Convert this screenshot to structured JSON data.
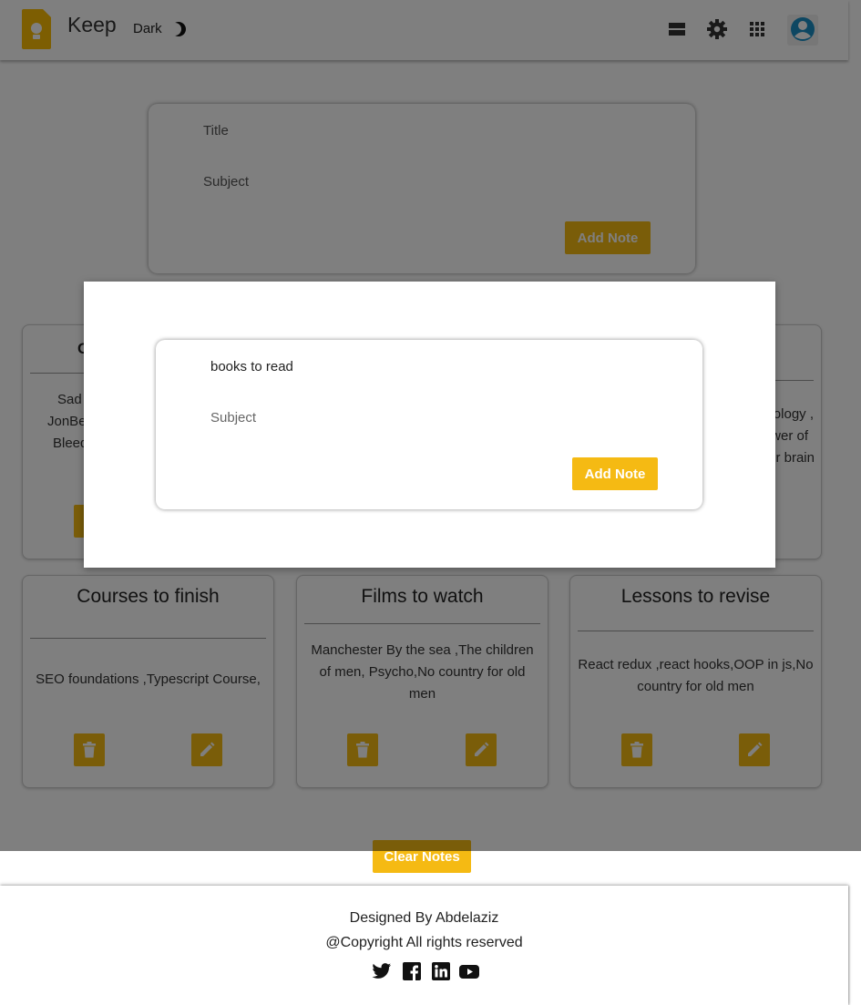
{
  "header": {
    "brand": "Keep",
    "mode_label": "Dark",
    "icons": [
      "moon-icon",
      "list-view-icon",
      "settings-gear-icon",
      "apps-grid-icon",
      "user-avatar-icon"
    ]
  },
  "note_form": {
    "title_placeholder": "Title",
    "subject_placeholder": "Subject",
    "add_label": "Add Note"
  },
  "notes": [
    {
      "title": "Courses to finish",
      "body": "SEO foundations ,Typescript Course,"
    },
    {
      "title": "Films to watch",
      "body": "Manchester By the sea ,The children of men, Psycho,No country for old men"
    },
    {
      "title": "Lessons to revise",
      "body": "React redux ,react hooks,OOP in js,No country for old men"
    }
  ],
  "partial_notes": {
    "left_title": "C",
    "left_lines": [
      "Sad",
      "JonBe",
      "Bleed"
    ],
    "right_lines": [
      "ology ,",
      "wer of",
      "r brain"
    ]
  },
  "clear_label": "Clear Notes",
  "footer": {
    "designed_by": "Designed By Abdelaziz",
    "copyright": "@Copyright All rights reserved",
    "social_icons": [
      "twitter-icon",
      "facebook-icon",
      "linkedin-icon",
      "youtube-icon"
    ]
  },
  "modal": {
    "title_value": "books to read",
    "subject_placeholder": "Subject",
    "add_label": "Add Note"
  },
  "colors": {
    "accent": "#f5ba13",
    "logo": "#fbbc04",
    "avatar": "#1a8fc4",
    "overlay": "rgba(0,0,0,0.5)"
  }
}
